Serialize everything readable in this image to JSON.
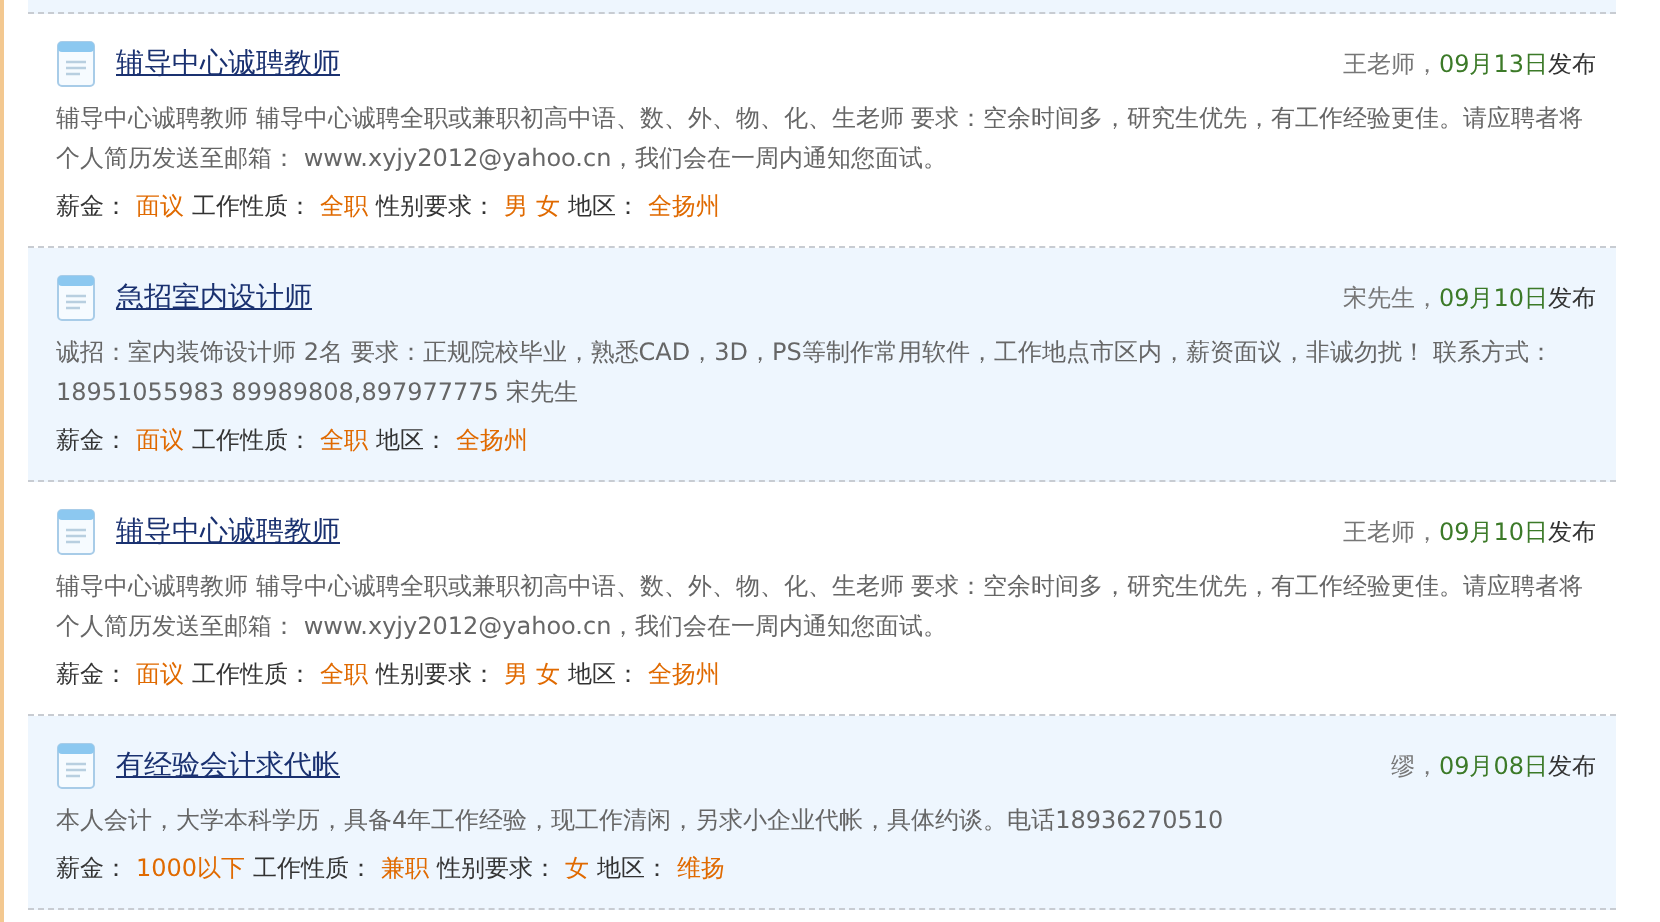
{
  "listings": [
    {
      "shaded": false,
      "title": "辅导中心诚聘教师",
      "author": "王老师",
      "separator": "，",
      "date": "09月13日",
      "posted": "发布",
      "description": "辅导中心诚聘教师 辅导中心诚聘全职或兼职初高中语、数、外、物、化、生老师 要求：空余时间多，研究生优先，有工作经验更佳。请应聘者将个人简历发送至邮箱： www.xyjy2012@yahoo.cn，我们会在一周内通知您面试。",
      "fields": [
        {
          "label": "薪金：",
          "value": "面议"
        },
        {
          "label": "工作性质：",
          "value": "全职"
        },
        {
          "label": "性别要求：",
          "value": "男 女"
        },
        {
          "label": "地区：",
          "value": "全扬州"
        }
      ]
    },
    {
      "shaded": true,
      "title": "急招室内设计师",
      "author": "宋先生",
      "separator": "，",
      "date": "09月10日",
      "posted": "发布",
      "description": "诚招：室内装饰设计师 2名 要求：正规院校毕业，熟悉CAD，3D，PS等制作常用软件，工作地点市区内，薪资面议，非诚勿扰！ 联系方式：18951055983 89989808,897977775 宋先生",
      "fields": [
        {
          "label": "薪金：",
          "value": "面议"
        },
        {
          "label": "工作性质：",
          "value": "全职"
        },
        {
          "label": "地区：",
          "value": "全扬州"
        }
      ]
    },
    {
      "shaded": false,
      "title": "辅导中心诚聘教师",
      "author": "王老师",
      "separator": "，",
      "date": "09月10日",
      "posted": "发布",
      "description": "辅导中心诚聘教师 辅导中心诚聘全职或兼职初高中语、数、外、物、化、生老师 要求：空余时间多，研究生优先，有工作经验更佳。请应聘者将个人简历发送至邮箱： www.xyjy2012@yahoo.cn，我们会在一周内通知您面试。",
      "fields": [
        {
          "label": "薪金：",
          "value": "面议"
        },
        {
          "label": "工作性质：",
          "value": "全职"
        },
        {
          "label": "性别要求：",
          "value": "男 女"
        },
        {
          "label": "地区：",
          "value": "全扬州"
        }
      ]
    },
    {
      "shaded": true,
      "title": "有经验会计求代帐",
      "author": "缪",
      "separator": "，",
      "date": "09月08日",
      "posted": "发布",
      "description": "本人会计，大学本科学历，具备4年工作经验，现工作清闲，另求小企业代帐，具体约谈。电话18936270510",
      "fields": [
        {
          "label": "薪金：",
          "value": "1000以下"
        },
        {
          "label": "工作性质：",
          "value": "兼职"
        },
        {
          "label": "性别要求：",
          "value": "女"
        },
        {
          "label": "地区：",
          "value": "维扬"
        }
      ]
    }
  ]
}
